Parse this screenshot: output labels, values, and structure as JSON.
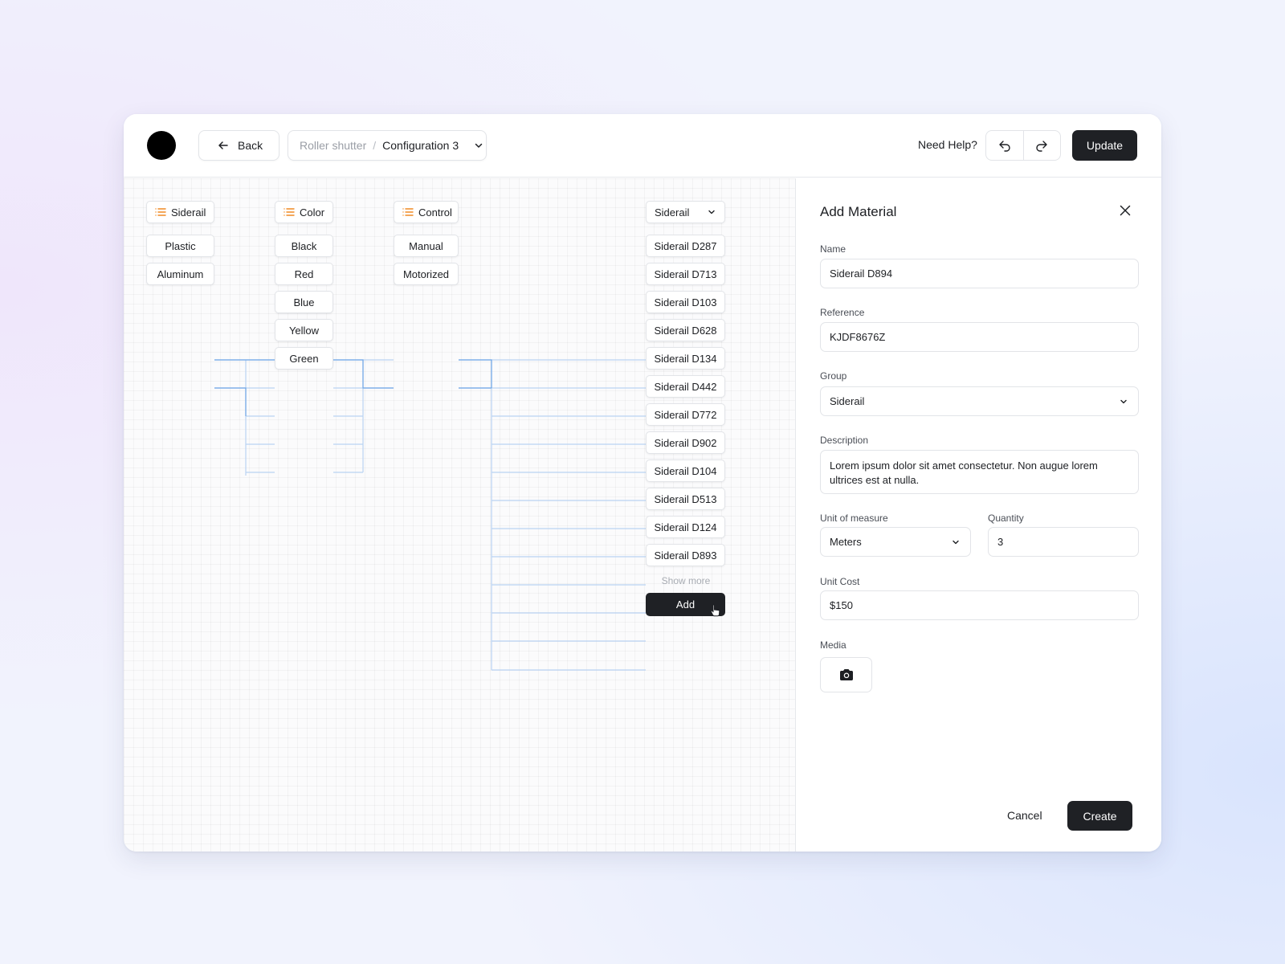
{
  "header": {
    "back_label": "Back",
    "breadcrumb": {
      "parent": "Roller shutter",
      "separator": "/",
      "current": "Configuration 3"
    },
    "help_label": "Need Help?",
    "update_label": "Update"
  },
  "canvas": {
    "columns": {
      "siderail_header": "Siderail",
      "color_header": "Color",
      "control_header": "Control",
      "material_select": "Siderail"
    },
    "materials": [
      "Plastic",
      "Aluminum"
    ],
    "colors": [
      "Black",
      "Red",
      "Blue",
      "Yellow",
      "Green"
    ],
    "controls": [
      "Manual",
      "Motorized"
    ],
    "siderails": [
      "Siderail D287",
      "Siderail D713",
      "Siderail D103",
      "Siderail D628",
      "Siderail D134",
      "Siderail D442",
      "Siderail D772",
      "Siderail D902",
      "Siderail D104",
      "Siderail D513",
      "Siderail D124",
      "Siderail D893"
    ],
    "show_more_label": "Show more",
    "add_label": "Add"
  },
  "panel": {
    "title": "Add Material",
    "name_label": "Name",
    "name_value": "Siderail D894",
    "reference_label": "Reference",
    "reference_value": "KJDF8676Z",
    "group_label": "Group",
    "group_value": "Siderail",
    "description_label": "Description",
    "description_value": "Lorem ipsum dolor sit amet consectetur. Non augue lorem ultrices est at nulla.",
    "unit_label": "Unit of measure",
    "unit_value": "Meters",
    "quantity_label": "Quantity",
    "quantity_value": "3",
    "unit_cost_label": "Unit Cost",
    "unit_cost_value": "$150",
    "media_label": "Media",
    "cancel_label": "Cancel",
    "create_label": "Create"
  },
  "colors": {
    "accent_dark": "#1f2125",
    "link_blue": "#4a90e2",
    "list_icon_orange": "#f08a24"
  },
  "icons": [
    "arrow-left-icon",
    "chevron-down-icon",
    "undo-icon",
    "redo-icon",
    "list-icon",
    "close-icon",
    "camera-icon",
    "pointer-cursor-icon"
  ]
}
